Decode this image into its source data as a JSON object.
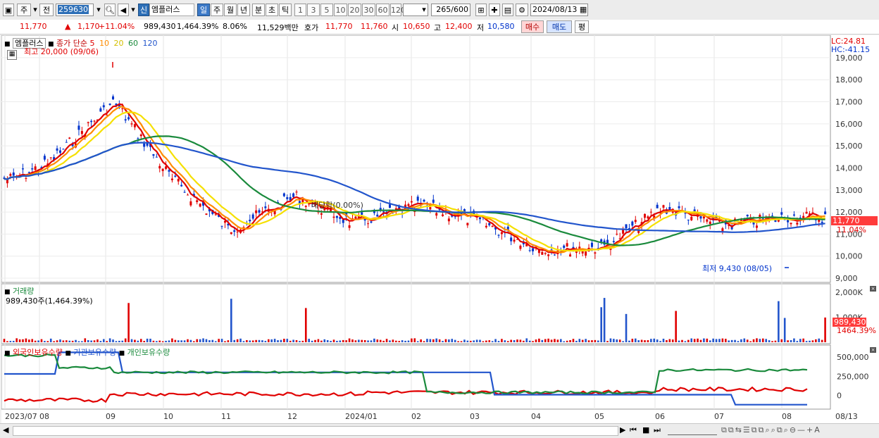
{
  "toolbar": {
    "market": "주",
    "prev_btn": "전",
    "code": "259630",
    "badge": "신",
    "stock_name": "엠플러스",
    "periods": [
      "일",
      "주",
      "월",
      "년",
      "분",
      "초",
      "틱"
    ],
    "active_period": "일",
    "intervals": [
      "1",
      "3",
      "5",
      "10",
      "20",
      "30",
      "60",
      "120"
    ],
    "count": "265",
    "count_total": "/600",
    "date": "2024/08/13"
  },
  "quote": {
    "price": "11,770",
    "change": "1,170",
    "change_pct": "+11.04%",
    "volume": "989,430",
    "volume_pct": "1,464.39%",
    "turnover": "8.06%",
    "amount": "11,529백만",
    "ask_label": "호가",
    "ask": "11,770",
    "bid": "11,760",
    "open_label": "시",
    "open": "10,650",
    "high_label": "고",
    "high": "12,400",
    "low_label": "저",
    "low": "10,580",
    "buy_btn": "매수",
    "sell_btn": "매도",
    "eval_btn": "평"
  },
  "price_panel": {
    "title": "엠플러스",
    "ma_label": "종가 단순",
    "ma_periods": [
      "5",
      "10",
      "20",
      "60",
      "120"
    ],
    "ma_colors": [
      "#e00000",
      "#ff8c00",
      "#f5e000",
      "#1a8a3c",
      "#2255cc"
    ],
    "high_note": "최고 20,000 (09/06)",
    "low_note": "최저 9,430 (08/05)",
    "event_note": "배당락(0.00%)",
    "lc": "LC:24.81",
    "hc": "HC:-41.15",
    "price_tag": "11,770",
    "pct_tag": "11.04%",
    "y_ticks": [
      "19,000",
      "18,000",
      "17,000",
      "16,000",
      "15,000",
      "14,000",
      "13,000",
      "12,000",
      "11,000",
      "10,000",
      "9,000"
    ]
  },
  "volume_panel": {
    "title": "거래량",
    "value": "989,430주(1,464.39%)",
    "y_ticks": [
      "2,000K",
      "1,000K"
    ],
    "tag_value": "989,430",
    "tag_pct": "1464.39%"
  },
  "holdings_panel": {
    "series": [
      "외국인보유수량",
      "기관보유수량",
      "개인보유수량"
    ],
    "colors": [
      "#e00000",
      "#2255cc",
      "#1a8a3c"
    ],
    "y_ticks": [
      "500,000",
      "250,000",
      "0"
    ]
  },
  "x_axis": [
    "2023/07",
    "08",
    "09",
    "10",
    "11",
    "12",
    "2024/01",
    "02",
    "03",
    "04",
    "05",
    "06",
    "07",
    "08"
  ],
  "x_axis_right": "08/13",
  "chart_data": {
    "type": "line",
    "title": "",
    "ylabel": "",
    "ylim": [
      9000,
      19700
    ],
    "x": [
      "2023/07",
      "08",
      "09",
      "10",
      "11",
      "12",
      "2024/01",
      "02",
      "03",
      "04",
      "05",
      "06",
      "07",
      "08"
    ],
    "series": [
      {
        "name": "종가",
        "values": [
          13500,
          14200,
          17000,
          13500,
          11200,
          12700,
          11500,
          12300,
          11600,
          10300,
          10400,
          12200,
          11400,
          11770
        ]
      }
    ]
  }
}
